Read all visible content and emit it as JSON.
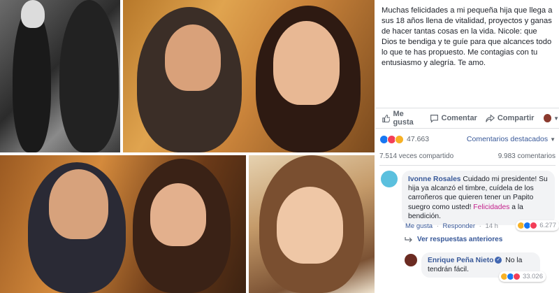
{
  "post": {
    "text": "Muchas felicidades a mi pequeña hija que llega a sus 18 años llena de vitalidad, proyectos y ganas de hacer tantas cosas en la vida. Nicole: que Dios te bendiga y te guíe para que alcances todo lo que te has propuesto. Me contagias con tu entusiasmo y alegría. Te amo."
  },
  "actions": {
    "like": "Me gusta",
    "comment": "Comentar",
    "share": "Compartir"
  },
  "reactions": {
    "count": "47.663",
    "top_comments": "Comentarios destacados",
    "icons": [
      "like-icon",
      "love-icon",
      "haha-icon"
    ]
  },
  "stats": {
    "shares": "7.514 veces compartido",
    "comments": "9.983 comentarios"
  },
  "comments": [
    {
      "name": "Ivonne Rosales",
      "text_a": " Cuidado mi presidente! Su hija ya alcanzó el timbre, cuídela de los carroñeros que quieren tener un Papito suegro como usted! ",
      "highlight": "Felicidades",
      "text_b": " a la bendición.",
      "reaction_count": "6.277",
      "like": "Me gusta",
      "reply": "Responder",
      "time": "14 h",
      "avatar_color": "#5bc0de"
    },
    {
      "name": "Enrique Peña Nieto",
      "text": " No la tendrán fácil.",
      "reaction_count": "33.026",
      "avatar_color": "#6b2b22"
    }
  ],
  "view_previous": "Ver respuestas anteriores",
  "colors": {
    "link": "#385898",
    "muted": "#606770",
    "highlight": "#c3208b"
  }
}
